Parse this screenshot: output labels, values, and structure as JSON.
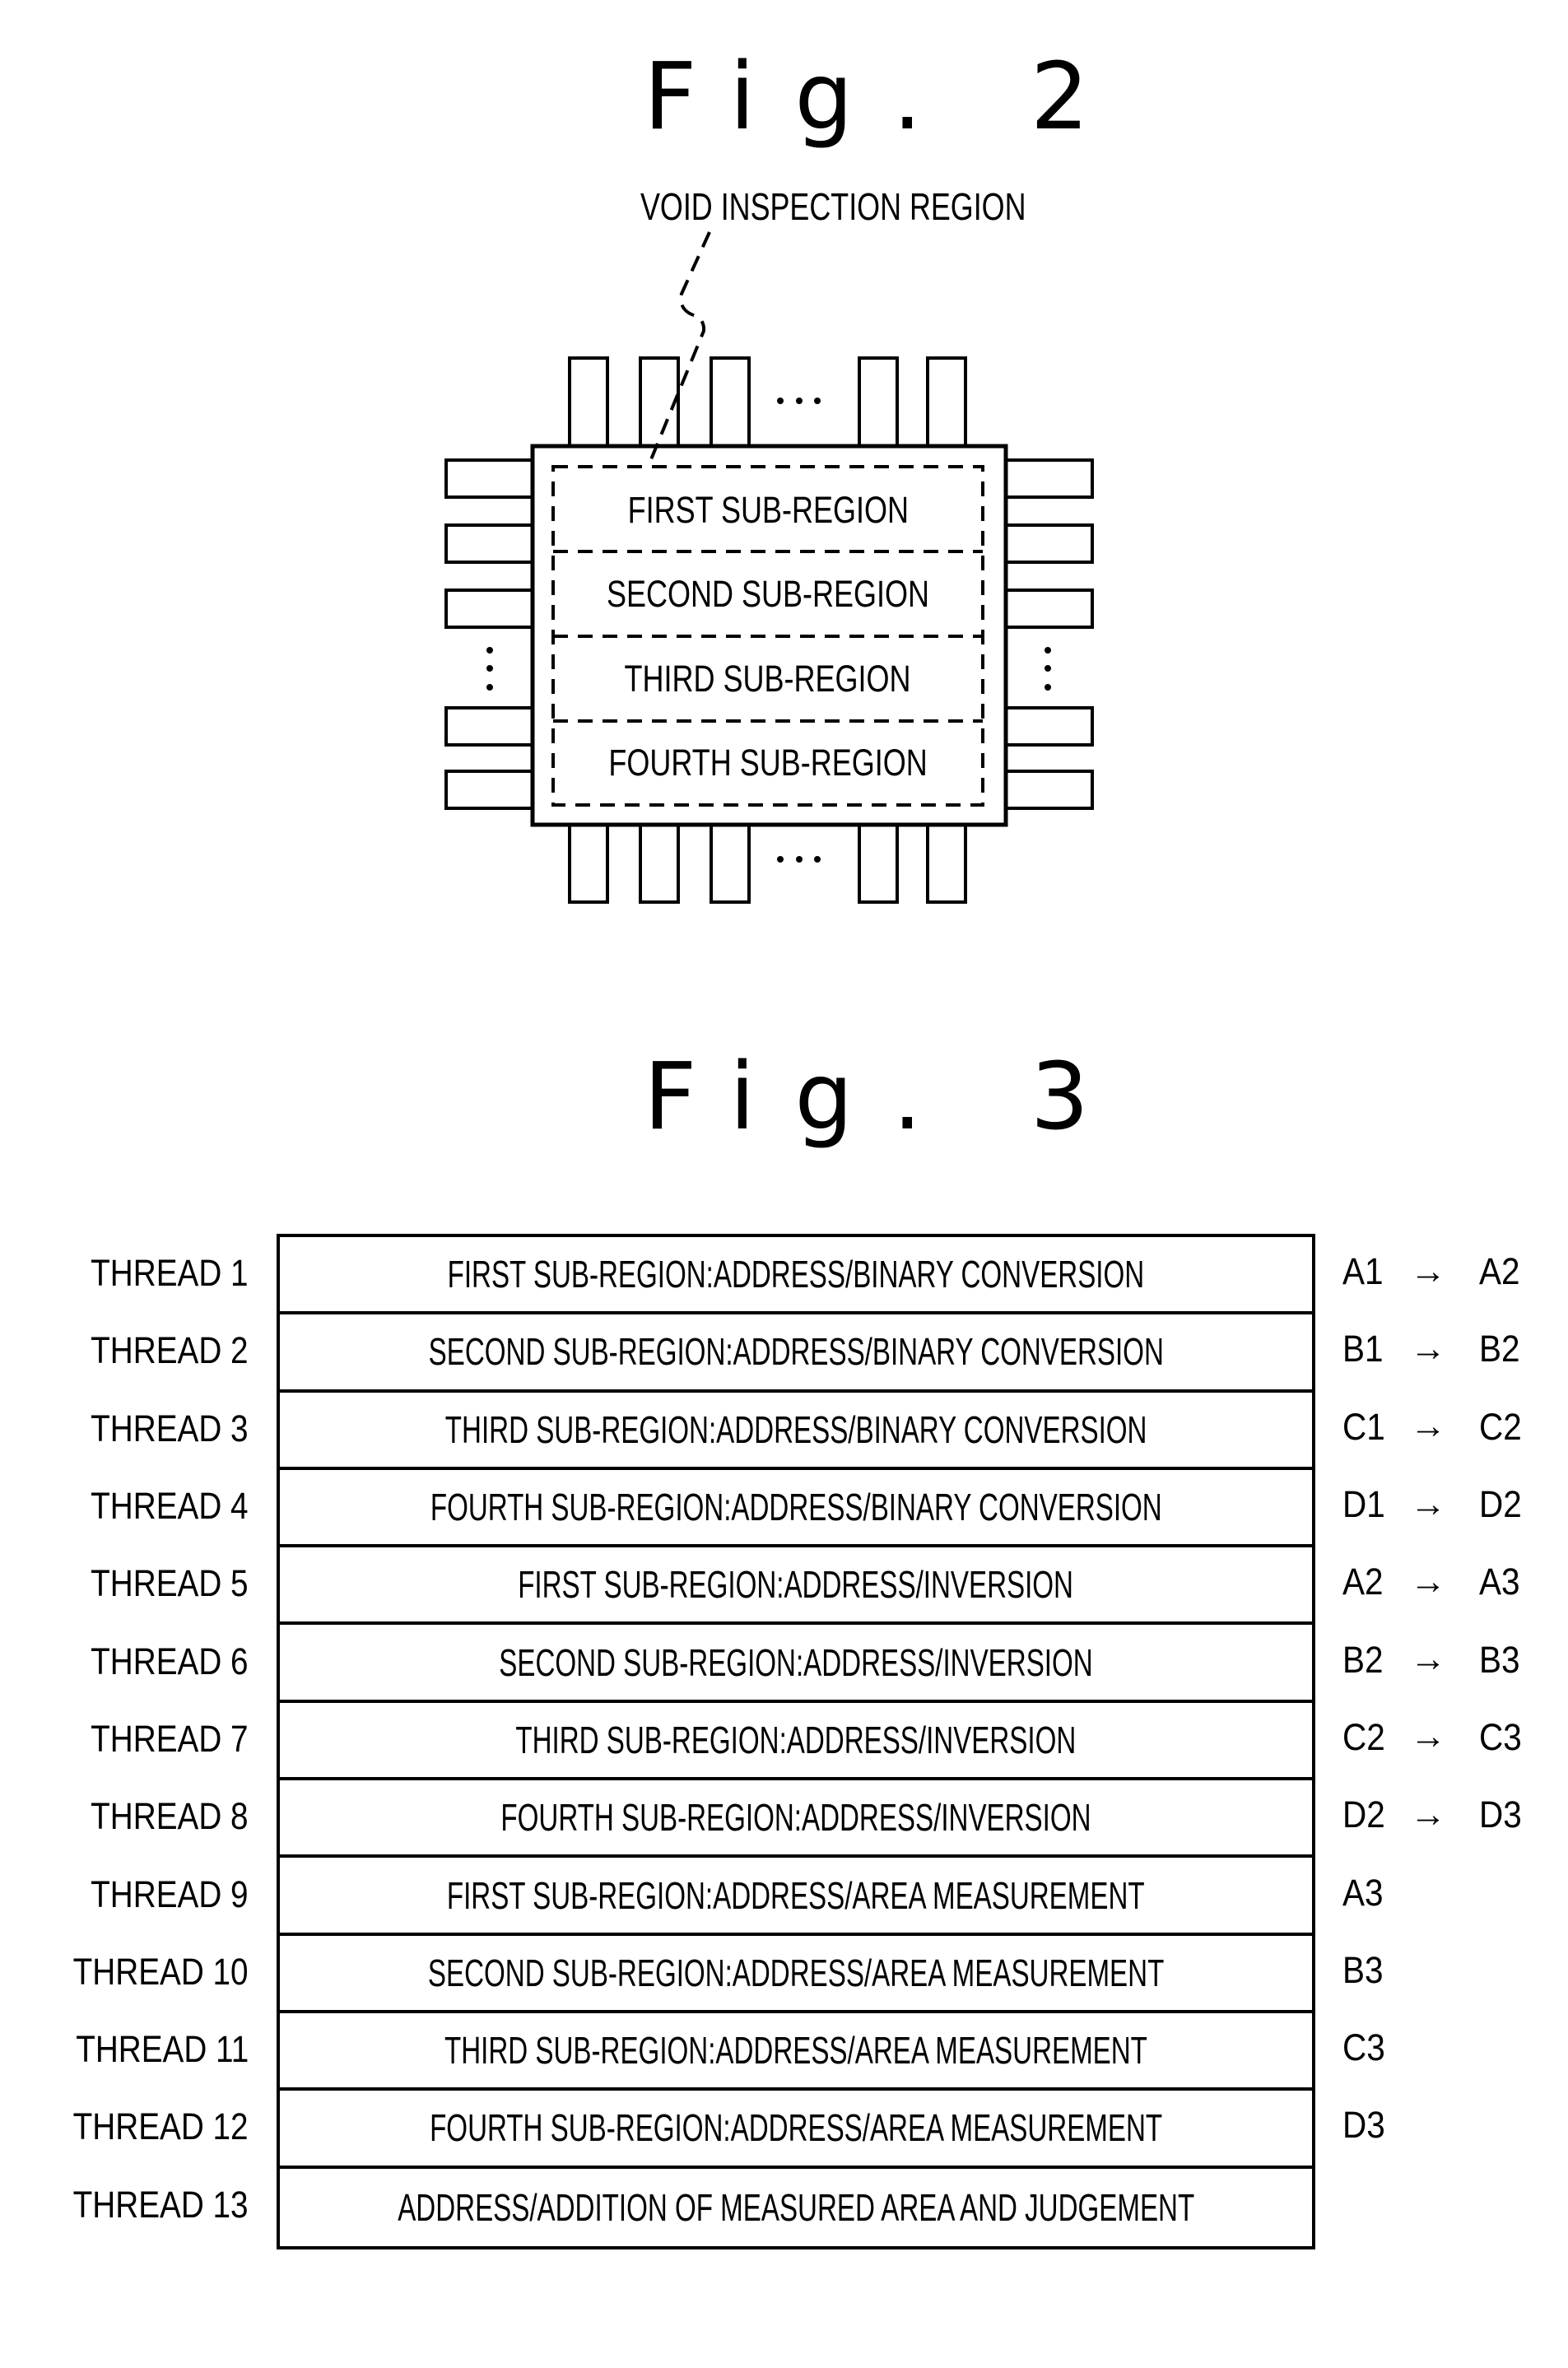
{
  "figure2": {
    "title": "Fig. 2",
    "leader_label": "VOID INSPECTION REGION",
    "sub_regions": [
      {
        "label": "FIRST SUB-REGION"
      },
      {
        "label": "SECOND SUB-REGION"
      },
      {
        "label": "THIRD SUB-REGION"
      },
      {
        "label": "FOURTH SUB-REGION"
      }
    ],
    "ellipsis_horizontal": "…",
    "ellipsis_vertical": "⋮"
  },
  "figure3": {
    "title": "Fig. 3",
    "rows": [
      {
        "thread": "THREAD 1",
        "task": "FIRST SUB-REGION:ADDRESS/BINARY CONVERSION",
        "from": "A1",
        "arrow": "→",
        "to": "A2"
      },
      {
        "thread": "THREAD 2",
        "task": "SECOND SUB-REGION:ADDRESS/BINARY CONVERSION",
        "from": "B1",
        "arrow": "→",
        "to": "B2"
      },
      {
        "thread": "THREAD 3",
        "task": "THIRD SUB-REGION:ADDRESS/BINARY CONVERSION",
        "from": "C1",
        "arrow": "→",
        "to": "C2"
      },
      {
        "thread": "THREAD 4",
        "task": "FOURTH SUB-REGION:ADDRESS/BINARY CONVERSION",
        "from": "D1",
        "arrow": "→",
        "to": "D2"
      },
      {
        "thread": "THREAD 5",
        "task": "FIRST SUB-REGION:ADDRESS/INVERSION",
        "from": "A2",
        "arrow": "→",
        "to": "A3"
      },
      {
        "thread": "THREAD 6",
        "task": "SECOND SUB-REGION:ADDRESS/INVERSION",
        "from": "B2",
        "arrow": "→",
        "to": "B3"
      },
      {
        "thread": "THREAD 7",
        "task": "THIRD SUB-REGION:ADDRESS/INVERSION",
        "from": "C2",
        "arrow": "→",
        "to": "C3"
      },
      {
        "thread": "THREAD 8",
        "task": "FOURTH SUB-REGION:ADDRESS/INVERSION",
        "from": "D2",
        "arrow": "→",
        "to": "D3"
      },
      {
        "thread": "THREAD 9",
        "task": "FIRST SUB-REGION:ADDRESS/AREA MEASUREMENT",
        "from": "A3",
        "arrow": "",
        "to": ""
      },
      {
        "thread": "THREAD 10",
        "task": "SECOND SUB-REGION:ADDRESS/AREA MEASUREMENT",
        "from": "B3",
        "arrow": "",
        "to": ""
      },
      {
        "thread": "THREAD 11",
        "task": "THIRD SUB-REGION:ADDRESS/AREA MEASUREMENT",
        "from": "C3",
        "arrow": "",
        "to": ""
      },
      {
        "thread": "THREAD 12",
        "task": "FOURTH SUB-REGION:ADDRESS/AREA MEASUREMENT",
        "from": "D3",
        "arrow": "",
        "to": ""
      },
      {
        "thread": "THREAD 13",
        "task": "ADDRESS/ADDITION OF MEASURED AREA AND JUDGEMENT",
        "from": "",
        "arrow": "",
        "to": ""
      }
    ]
  }
}
